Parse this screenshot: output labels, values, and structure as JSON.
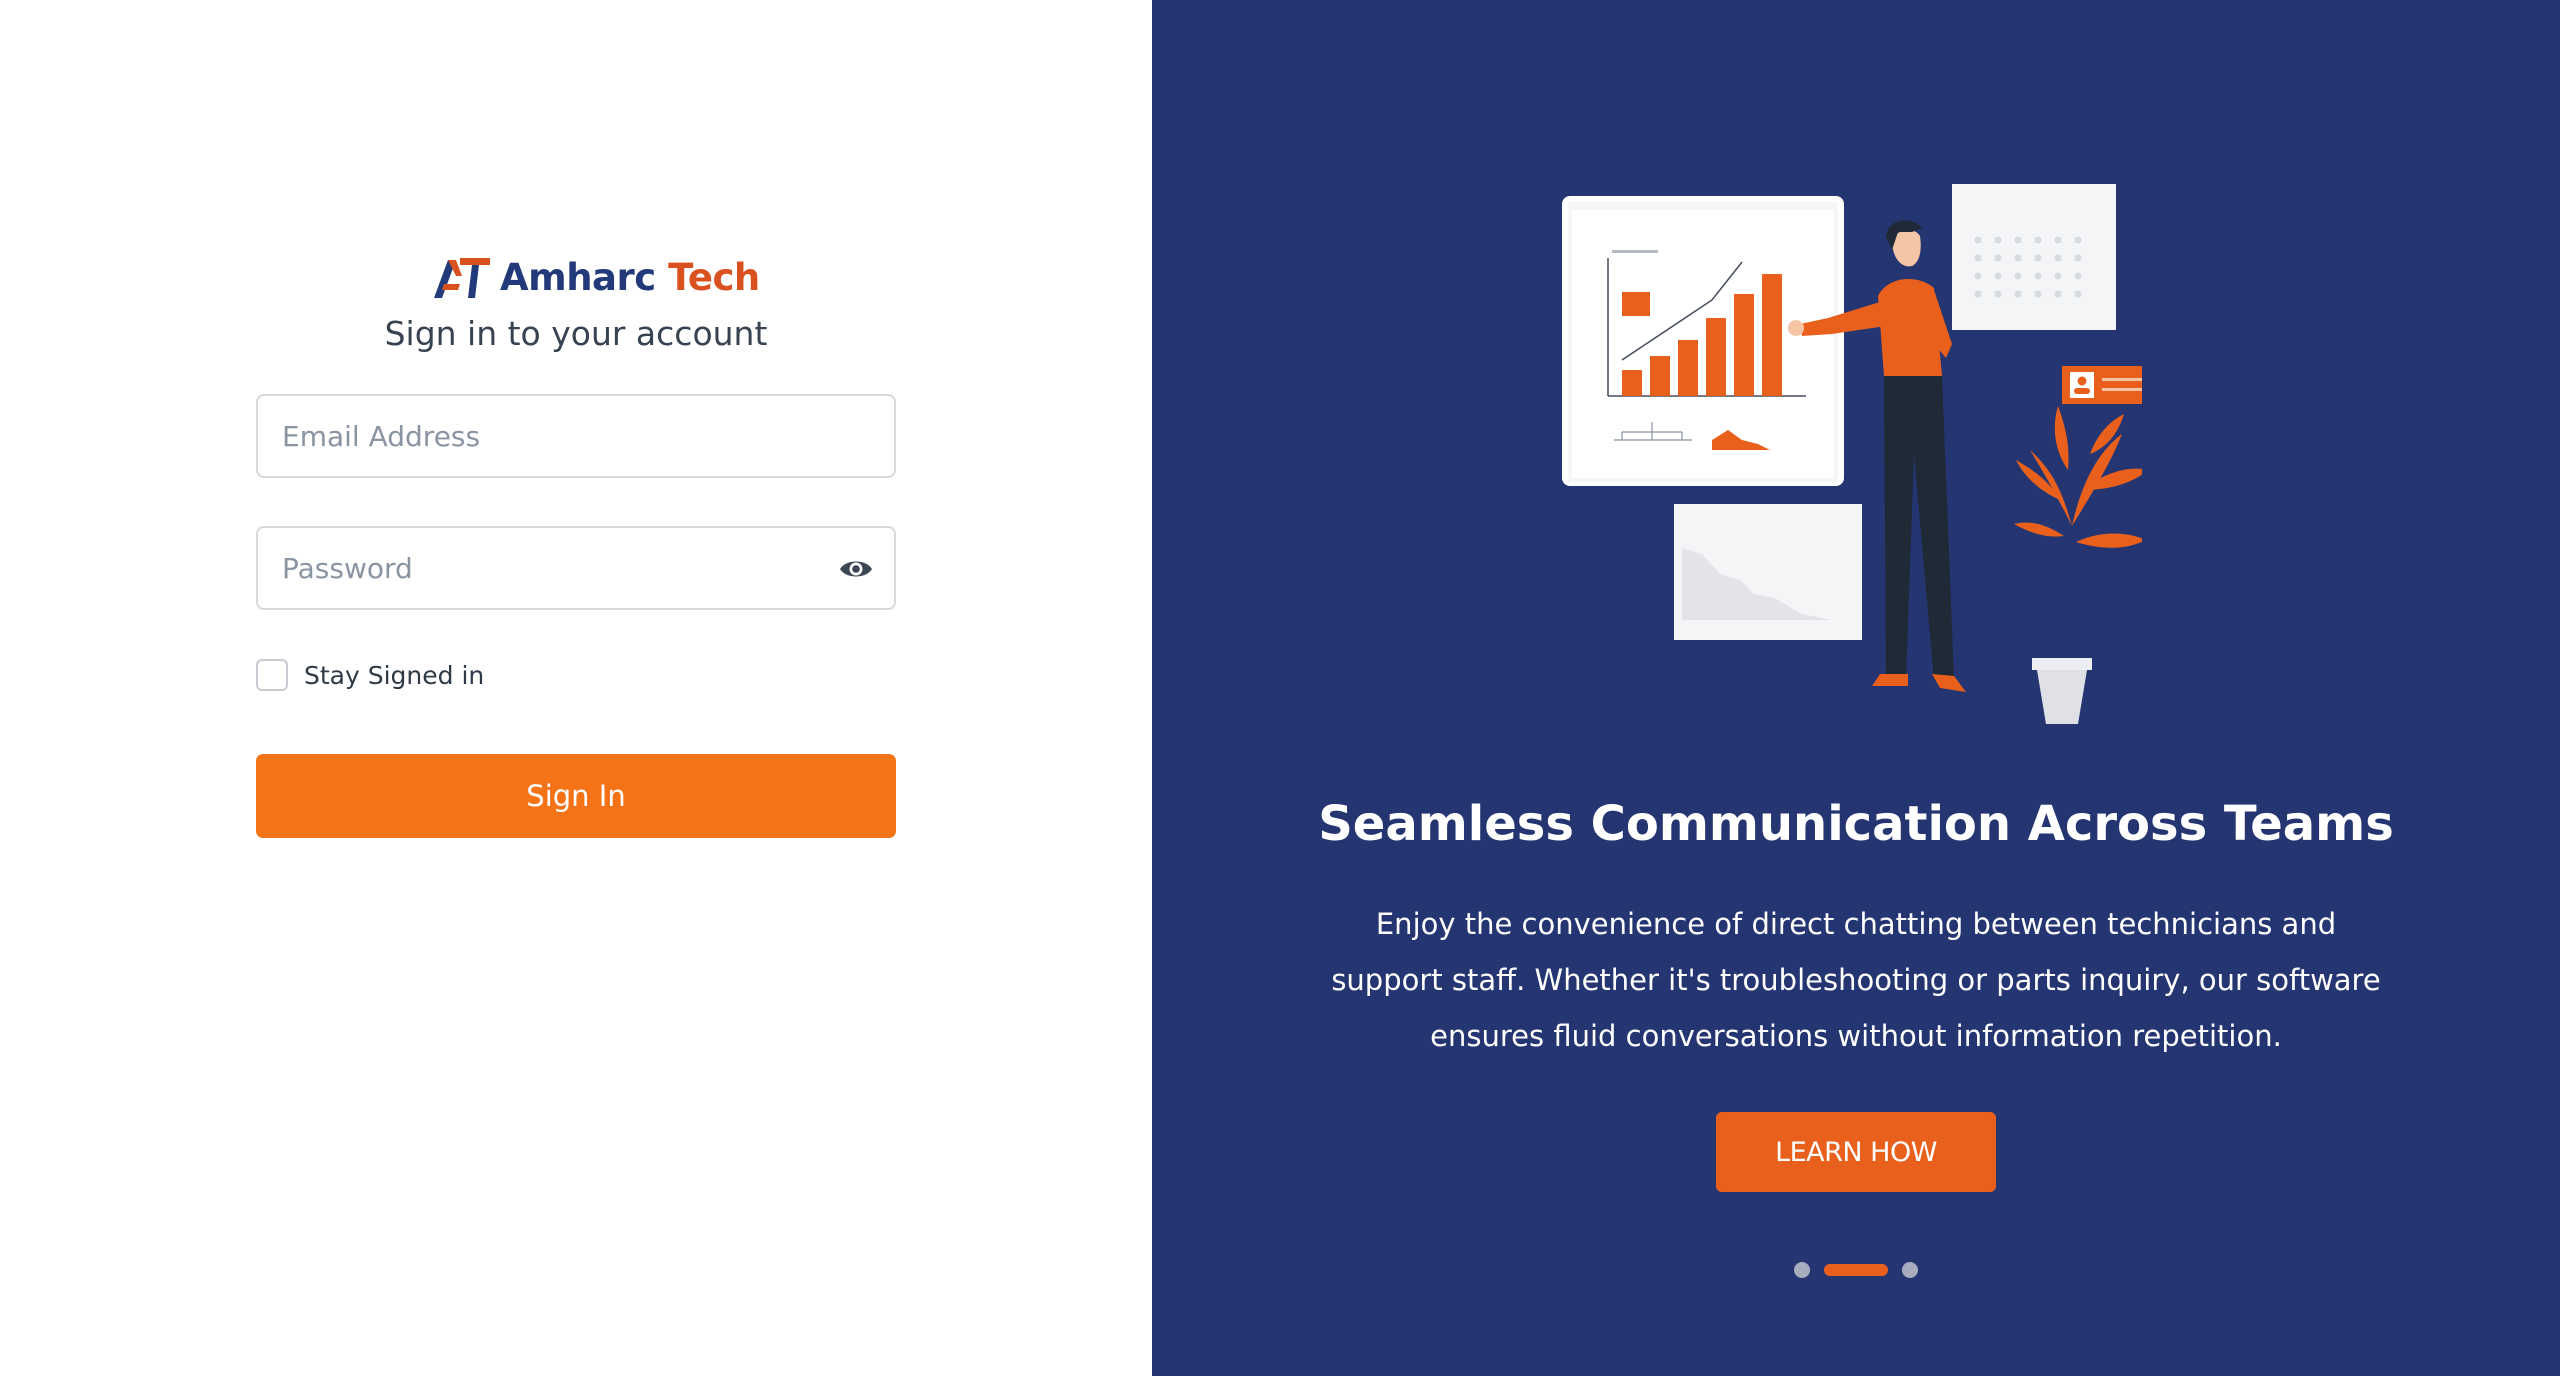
{
  "brand": {
    "name_part1": "Amharc",
    "name_part2": "Tech",
    "primary_color": "#233a7a",
    "accent_color": "#d8511e"
  },
  "login": {
    "title": "Sign in to your account",
    "email_placeholder": "Email Address",
    "password_placeholder": "Password",
    "remember_label": "Stay Signed in",
    "submit_label": "Sign In",
    "button_color": "#f47317"
  },
  "promo": {
    "background_color": "#243571",
    "headline": "Seamless Communication Across Teams",
    "description": "Enjoy the convenience of direct chatting between technicians and support staff. Whether it's troubleshooting or parts inquiry, our software ensures fluid conversations without information repetition.",
    "cta_label": "LEARN HOW",
    "carousel": {
      "slide_count": 3,
      "active_index": 1
    }
  },
  "icons": {
    "logo": "amharc-logo-icon",
    "password_toggle": "eye-icon",
    "illustration": "presentation-illustration"
  }
}
